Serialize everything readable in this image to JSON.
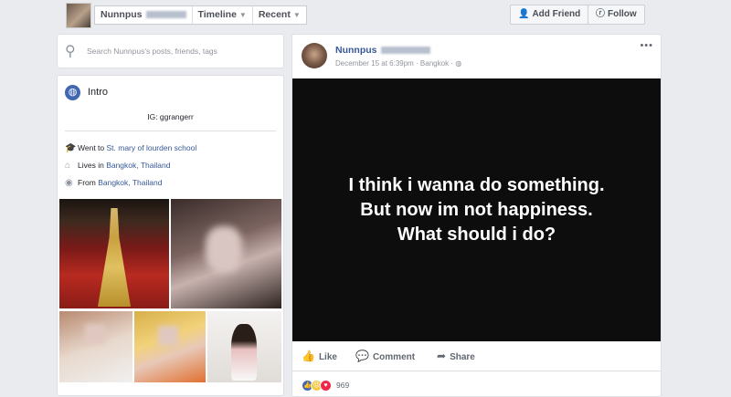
{
  "profile": {
    "name": "Nunnpus",
    "avatar_icon": "profile-photo"
  },
  "nav": {
    "tabs": [
      {
        "label": "Nunnpus"
      },
      {
        "label": "Timeline"
      },
      {
        "label": "Recent"
      }
    ],
    "add_friend": "Add Friend",
    "follow": "Follow"
  },
  "search": {
    "placeholder": "Search Nunnpus's posts, friends, tags"
  },
  "intro": {
    "title": "Intro",
    "ig": "IG: ggrangerr",
    "education_prefix": "Went to ",
    "education_link": "St. mary of lourden school",
    "lives_prefix": "Lives in ",
    "lives_link": "Bangkok, Thailand",
    "from_prefix": "From ",
    "from_link": "Bangkok, Thailand"
  },
  "post": {
    "author": "Nunnpus",
    "date": "December 15 at 6:39pm · Bangkok · ",
    "text_lines": [
      "I think i wanna do something.",
      "But now im not happiness.",
      "What should i do?"
    ],
    "background_color": "#0d0d0d",
    "like": "Like",
    "comment": "Comment",
    "share": "Share",
    "reaction_count": "969",
    "reactions": [
      "like-reaction",
      "sad-reaction",
      "love-reaction"
    ]
  },
  "colors": {
    "link": "#365899",
    "page_bg": "#e9ebee"
  }
}
